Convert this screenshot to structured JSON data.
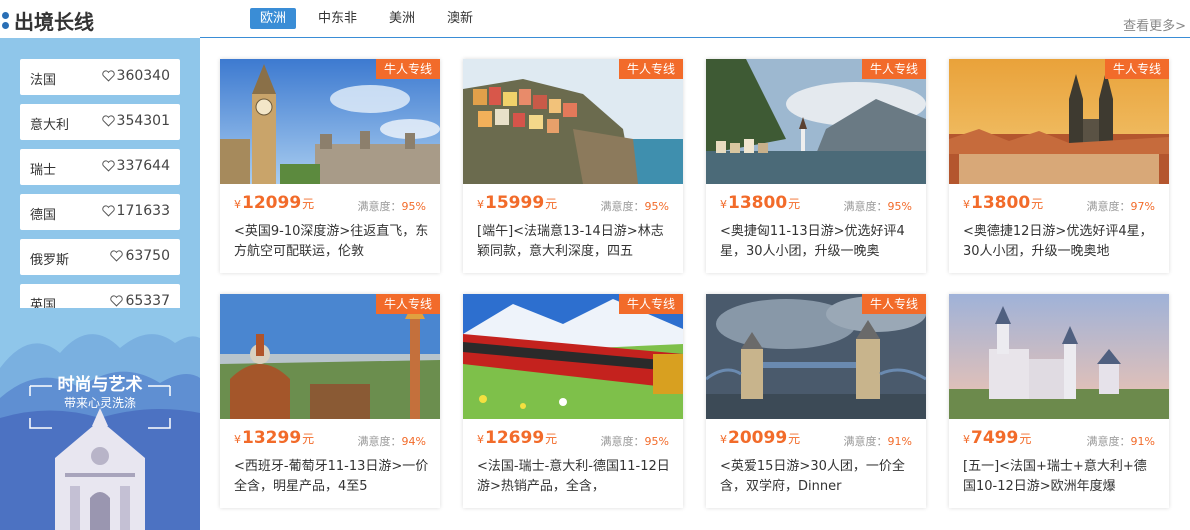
{
  "header": {
    "title": "出境长线",
    "tabs": [
      "欧洲",
      "中东非",
      "美洲",
      "澳新"
    ],
    "more": "查看更多>"
  },
  "sidebar": {
    "items": [
      {
        "name": "法国",
        "likes": "360340"
      },
      {
        "name": "意大利",
        "likes": "354301"
      },
      {
        "name": "瑞士",
        "likes": "337644"
      },
      {
        "name": "德国",
        "likes": "171633"
      },
      {
        "name": "俄罗斯",
        "likes": "63750"
      },
      {
        "name": "英国",
        "likes": "65337"
      }
    ],
    "banner": {
      "title": "时尚与艺术",
      "subtitle": "带来心灵洗涤"
    }
  },
  "products": [
    {
      "tag": "牛人专线",
      "currency": "¥",
      "price": "12099",
      "unit": "元",
      "sat_label": "满意度：",
      "sat_value": "95%",
      "desc": "<英国9-10深度游>往返直飞，东方航空可配联运，伦敦"
    },
    {
      "tag": "牛人专线",
      "currency": "¥",
      "price": "15999",
      "unit": "元",
      "sat_label": "满意度：",
      "sat_value": "95%",
      "desc": "[端午]<法瑞意13-14日游>林志颖同款，意大利深度，四五"
    },
    {
      "tag": "牛人专线",
      "currency": "¥",
      "price": "13800",
      "unit": "元",
      "sat_label": "满意度：",
      "sat_value": "95%",
      "desc": "<奥捷匈11-13日游>优选好评4星，30人小团，升级一晚奥"
    },
    {
      "tag": "牛人专线",
      "currency": "¥",
      "price": "13800",
      "unit": "元",
      "sat_label": "满意度：",
      "sat_value": "97%",
      "desc": "<奥德捷12日游>优选好评4星，30人小团，升级一晚奥地"
    },
    {
      "tag": "牛人专线",
      "currency": "¥",
      "price": "13299",
      "unit": "元",
      "sat_label": "满意度：",
      "sat_value": "94%",
      "desc": "<西班牙-葡萄牙11-13日游>一价全含，明星产品，4至5"
    },
    {
      "tag": "牛人专线",
      "currency": "¥",
      "price": "12699",
      "unit": "元",
      "sat_label": "满意度：",
      "sat_value": "95%",
      "desc": "<法国-瑞士-意大利-德国11-12日游>热销产品，全含，"
    },
    {
      "tag": "牛人专线",
      "currency": "¥",
      "price": "20099",
      "unit": "元",
      "sat_label": "满意度：",
      "sat_value": "91%",
      "desc": "<英爱15日游>30人团，一价全含，双学府，Dinner"
    },
    {
      "tag": "",
      "currency": "¥",
      "price": "7499",
      "unit": "元",
      "sat_label": "满意度：",
      "sat_value": "91%",
      "desc": "[五一]<法国+瑞士+意大利+德国10-12日游>欧洲年度爆"
    }
  ],
  "colors": {
    "accent": "#3a8dd6",
    "orange": "#f26b2a",
    "sidebar": "#8fc6ea"
  }
}
